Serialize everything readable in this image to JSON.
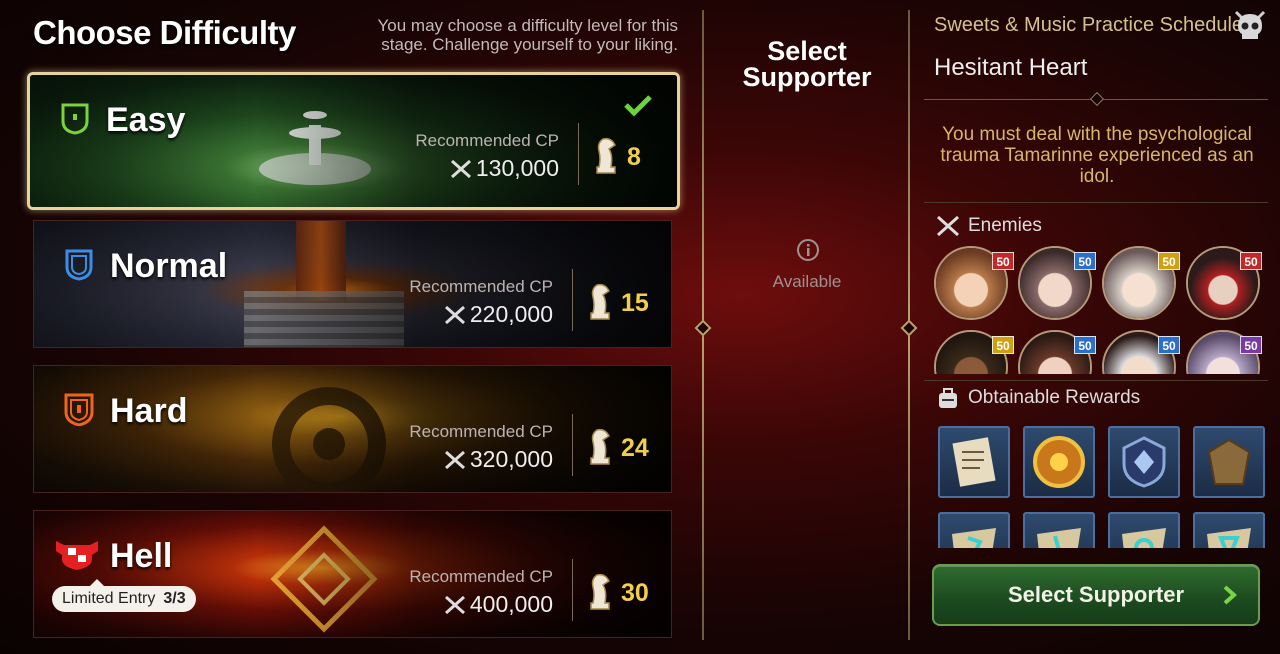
{
  "header": {
    "title": "Choose Difficulty",
    "subtitle": "You may choose a difficulty level for this stage. Challenge yourself to your liking."
  },
  "difficulties": [
    {
      "name": "Easy",
      "rec_label": "Recommended CP",
      "rec_value": "130,000",
      "tickets": "8",
      "selected": true
    },
    {
      "name": "Normal",
      "rec_label": "Recommended CP",
      "rec_value": "220,000",
      "tickets": "15",
      "selected": false
    },
    {
      "name": "Hard",
      "rec_label": "Recommended CP",
      "rec_value": "320,000",
      "tickets": "24",
      "selected": false
    },
    {
      "name": "Hell",
      "rec_label": "Recommended CP",
      "rec_value": "400,000",
      "tickets": "30",
      "selected": false,
      "limited_label": "Limited Entry",
      "limited_count": "3/3"
    }
  ],
  "supporter": {
    "title": "Select Supporter",
    "status": "Available"
  },
  "stage": {
    "series": "Sweets & Music Practice Schedule",
    "name": "Hesitant Heart",
    "description": "You must deal with the psychological trauma Tamarinne experienced as an idol."
  },
  "enemies": {
    "label": "Enemies",
    "levels": [
      "50",
      "50",
      "50",
      "50",
      "50",
      "50",
      "50",
      "50"
    ],
    "level_colors": [
      "#c0282a",
      "#2b6fc9",
      "#d1a010",
      "#c0282a",
      "#d1a010",
      "#2b6fc9",
      "#2b6fc9",
      "#7a3aa6"
    ]
  },
  "rewards": {
    "label": "Obtainable Rewards",
    "items": [
      "scroll-icon",
      "sun-medal-icon",
      "shield-gem-icon",
      "bag-icon",
      "rune-icon",
      "rune-icon",
      "rune-icon",
      "rune-icon"
    ]
  },
  "action": {
    "select_supporter_label": "Select Supporter"
  },
  "colors": {
    "accent_gold": "#d7c18b",
    "selected_border": "#e8d39a",
    "ticket_count": "#f2cf4a",
    "button_green": "#2f6d2f"
  }
}
